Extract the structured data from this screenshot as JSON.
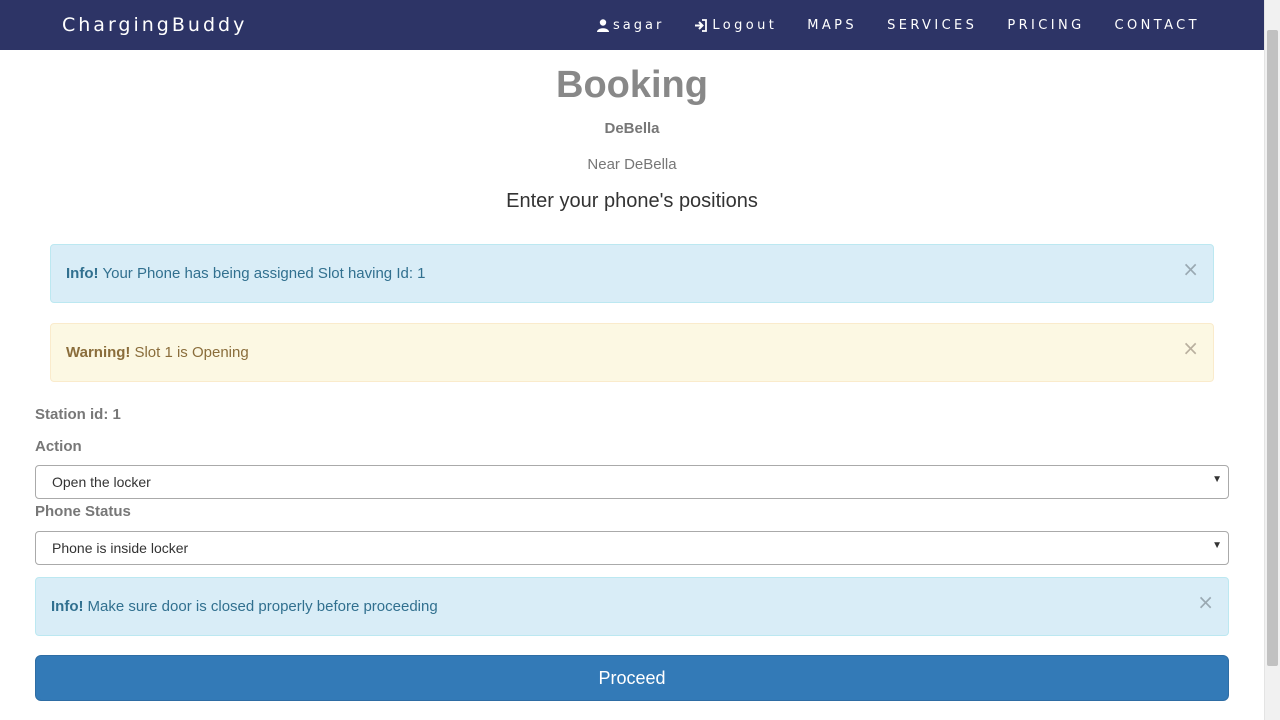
{
  "navbar": {
    "brand": "ChargingBuddy",
    "user": "sagar",
    "logout": "Logout",
    "maps": "MAPS",
    "services": "SERVICES",
    "pricing": "PRICING",
    "contact": "CONTACT",
    "background_color": "#2d3466"
  },
  "page": {
    "title": "Booking",
    "station_name": "DeBella",
    "station_desc": "Near DeBella",
    "subtitle": "Enter your phone's positions"
  },
  "alerts": {
    "slot_info": {
      "prefix": "Info!",
      "text": "Your Phone has being assigned Slot having Id: 1",
      "close": "×"
    },
    "slot_warning": {
      "prefix": "Warning!",
      "text": "Slot 1 is Opening",
      "close": "×"
    },
    "door_info": {
      "prefix": "Info!",
      "text": "Make sure door is closed properly before proceeding",
      "close": "×"
    }
  },
  "form": {
    "station_id_label": "Station id: 1",
    "action_label": "Action",
    "action_value": "Open the locker",
    "phone_status_label": "Phone Status",
    "phone_status_value": "Phone is inside locker",
    "proceed_label": "Proceed"
  },
  "colors": {
    "primary_button": "#337ab7",
    "info_bg": "#d9edf7",
    "warning_bg": "#fcf8e3"
  }
}
